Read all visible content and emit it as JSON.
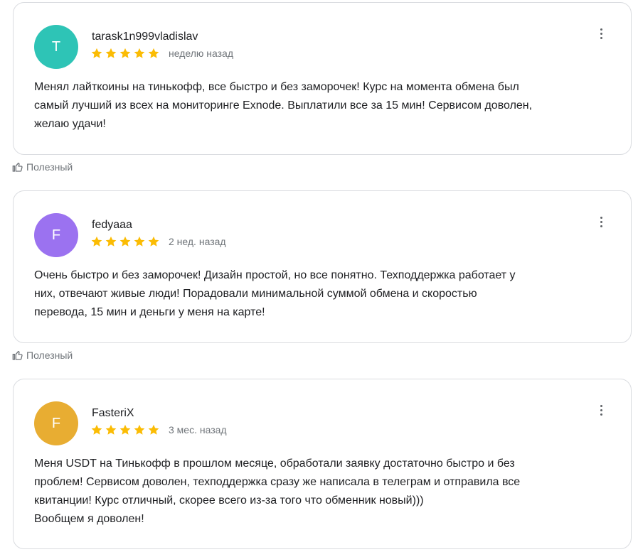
{
  "reviews": [
    {
      "avatar_letter": "T",
      "avatar_color": "#2ec4b6",
      "author": "tarask1n999vladislav",
      "stars": 5,
      "date": "неделю назад",
      "text": "Менял лайткоины на тинькофф, все быстро и без заморочек! Курс на момента обмена был\nсамый лучший из всех на мониторинге Exnode. Выплатили все за 15 мин! Сервисом доволен,\nжелаю удачи!",
      "helpful_label": "Полезный"
    },
    {
      "avatar_letter": "F",
      "avatar_color": "#9b72f0",
      "author": "fedyaaa",
      "stars": 5,
      "date": "2 нед. назад",
      "text": "Очень быстро и без заморочек! Дизайн простой, но все понятно. Техподдержка работает у\nних, отвечают живые люди! Порадовали минимальной суммой обмена и скоростью\nперевода, 15 мин и деньги у меня на карте!",
      "helpful_label": "Полезный"
    },
    {
      "avatar_letter": "F",
      "avatar_color": "#e8ad32",
      "author": "FasteriX",
      "stars": 5,
      "date": "3 мес. назад",
      "text": "Меня USDT на Тинькофф в прошлом месяце, обработали заявку достаточно быстро и без\nпроблем! Сервисом доволен, техподдержка сразу же написала в телеграм и отправила все\nквитанции! Курс отличный, скорее всего из-за того что обменник новый)))\nВообщем я доволен!"
    }
  ],
  "colors": {
    "star": "#fbbc04",
    "border": "#dadce0",
    "muted_text": "#70757a"
  },
  "icons": {
    "star": "star-icon",
    "menu": "more-vert-icon",
    "helpful": "thumb-up-icon"
  }
}
